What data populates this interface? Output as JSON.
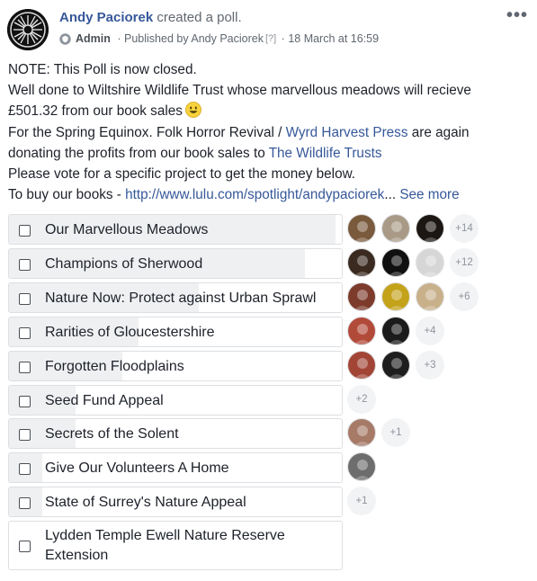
{
  "post": {
    "author": "Andy Paciorek",
    "action": "created a poll.",
    "role": "Admin",
    "published_prefix": "Published by Andy Paciorek",
    "help": "[?]",
    "date": "18 March at 16:59",
    "more": "•••"
  },
  "body": {
    "line1": "NOTE: This Poll is now closed.",
    "line2": "Well done to Wiltshire Wildlife Trust whose marvellous meadows will recieve",
    "line3": "£501.32 from our book sales",
    "line4_a": "For the Spring Equinox. Folk Horror Revival / ",
    "line4_link": "Wyrd Harvest Press",
    "line4_b": " are again",
    "line5_a": "donating the profits from our book sales to ",
    "line5_link": "The Wildlife Trusts",
    "line6": "Please vote for a specific project to get the money below.",
    "line7_a": "To buy our books - ",
    "line7_link": "http://www.lulu.com/spotlight/andypaciorek",
    "line7_b": "...",
    "see_more": "See more"
  },
  "poll": {
    "options": [
      {
        "label": "Our Marvellous Meadows",
        "fill": 0.98,
        "faces": 3,
        "more": "+14"
      },
      {
        "label": "Champions of Sherwood",
        "fill": 0.89,
        "faces": 3,
        "more": "+12"
      },
      {
        "label": "Nature Now: Protect against Urban Sprawl",
        "fill": 0.57,
        "faces": 3,
        "more": "+6"
      },
      {
        "label": "Rarities of Gloucestershire",
        "fill": 0.39,
        "faces": 2,
        "more": "+4"
      },
      {
        "label": "Forgotten Floodplains",
        "fill": 0.34,
        "faces": 2,
        "more": "+3"
      },
      {
        "label": "Seed Fund Appeal",
        "fill": 0.2,
        "faces": 0,
        "more": "+2"
      },
      {
        "label": "Secrets of the Solent",
        "fill": 0.2,
        "faces": 1,
        "more": "+1"
      },
      {
        "label": "Give Our Volunteers A Home",
        "fill": 0.1,
        "faces": 1,
        "more": ""
      },
      {
        "label": "State of Surrey's Nature Appeal",
        "fill": 0.1,
        "faces": 0,
        "more": "+1"
      },
      {
        "label": "Lydden Temple Ewell Nature Reserve",
        "label2": "Extension",
        "fill": 0.0,
        "faces": 0,
        "more": ""
      }
    ]
  },
  "colors": {
    "link": "#365899",
    "border": "#dddfe2",
    "fill": "#e9ebee"
  }
}
